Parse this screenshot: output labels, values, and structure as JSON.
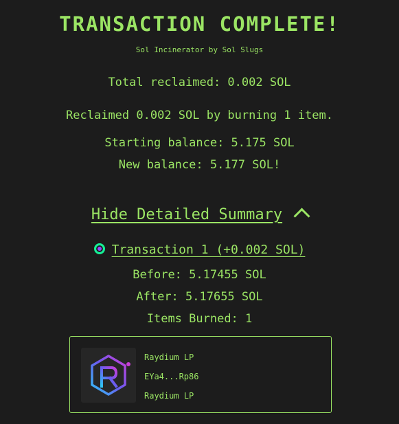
{
  "header": {
    "title": "TRANSACTION COMPLETE!",
    "subtitle": "Sol Incinerator by Sol Slugs"
  },
  "summary": {
    "total_reclaimed": "Total reclaimed: 0.002 SOL",
    "reclaimed_line": "Reclaimed 0.002 SOL by burning 1 item.",
    "starting_balance": "Starting balance: 5.175 SOL",
    "new_balance": "New balance: 5.177 SOL!"
  },
  "details": {
    "toggle_label": "Hide Detailed Summary",
    "transactions": [
      {
        "label": "Transaction 1 (+0.002 SOL)",
        "before": "Before: 5.17455 SOL",
        "after": "After: 5.17655 SOL",
        "items_burned": "Items Burned: 1",
        "items": [
          {
            "name": "Raydium LP",
            "address": "EYa4...Rp86",
            "collection": "Raydium LP",
            "icon": "raydium-logo-icon"
          }
        ]
      }
    ]
  },
  "colors": {
    "background": "#1c1c1c",
    "accent": "#9be564"
  }
}
